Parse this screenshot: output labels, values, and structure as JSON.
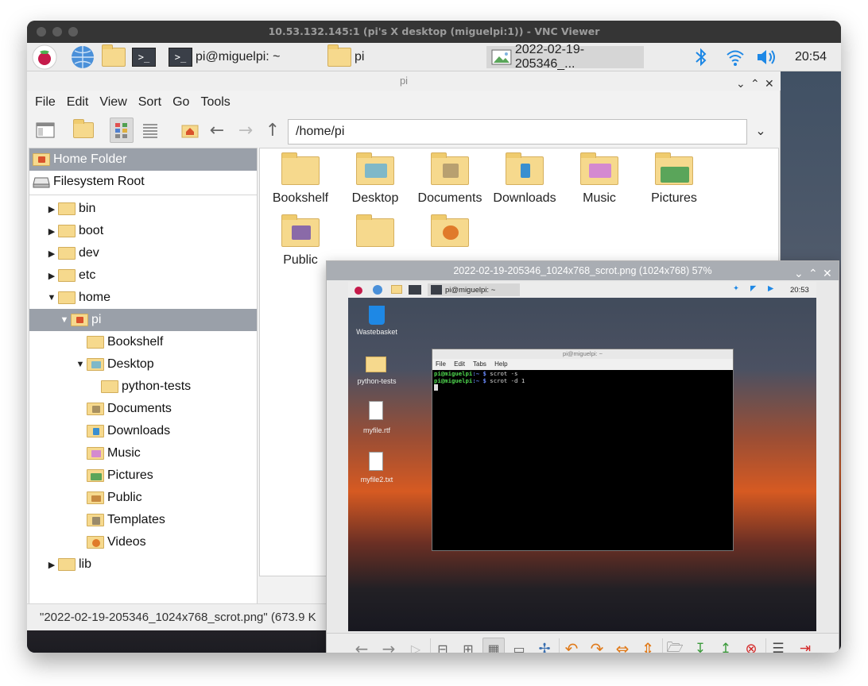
{
  "vnc": {
    "title": "10.53.132.145:1 (pi's X desktop (miguelpi:1)) - VNC Viewer"
  },
  "panel": {
    "terminal_task": "pi@miguelpi: ~",
    "folder_task": "pi",
    "image_task": "2022-02-19-205346_...",
    "clock": "20:54"
  },
  "filemanager": {
    "title": "pi",
    "menu": [
      "File",
      "Edit",
      "View",
      "Sort",
      "Go",
      "Tools"
    ],
    "path": "/home/pi",
    "places": [
      "Home Folder",
      "Filesystem Root"
    ],
    "tree": [
      {
        "label": "bin"
      },
      {
        "label": "boot"
      },
      {
        "label": "dev"
      },
      {
        "label": "etc"
      },
      {
        "label": "home"
      },
      {
        "label": "pi"
      },
      {
        "label": "Bookshelf"
      },
      {
        "label": "Desktop"
      },
      {
        "label": "python-tests"
      },
      {
        "label": "Documents"
      },
      {
        "label": "Downloads"
      },
      {
        "label": "Music"
      },
      {
        "label": "Pictures"
      },
      {
        "label": "Public"
      },
      {
        "label": "Templates"
      },
      {
        "label": "Videos"
      },
      {
        "label": "lib"
      }
    ],
    "items": [
      "Bookshelf",
      "Desktop",
      "Documents",
      "Downloads",
      "Music",
      "Pictures",
      "Public"
    ],
    "status": "\"2022-02-19-205346_1024x768_scrot.png\" (673.9 K"
  },
  "viewer": {
    "title": "2022-02-19-205346_1024x768_scrot.png (1024x768) 57%"
  },
  "screenshot": {
    "terminal_task": "pi@miguelpi: ~",
    "clock": "20:53",
    "desktop_icons": [
      "Wastebasket",
      "python-tests",
      "myfile.rtf",
      "myfile2.txt"
    ],
    "terminal": {
      "title": "pi@miguelpi: ~",
      "menu": [
        "File",
        "Edit",
        "Tabs",
        "Help"
      ],
      "prompt": "pi@miguelpi",
      "path": ":~ $",
      "cmd1": " scrot -s",
      "cmd2": " scrot -d 1"
    }
  },
  "colors": {
    "selection": "#9aa0a9",
    "folder": "#f6d98d",
    "accent_blue": "#1e88e5"
  }
}
